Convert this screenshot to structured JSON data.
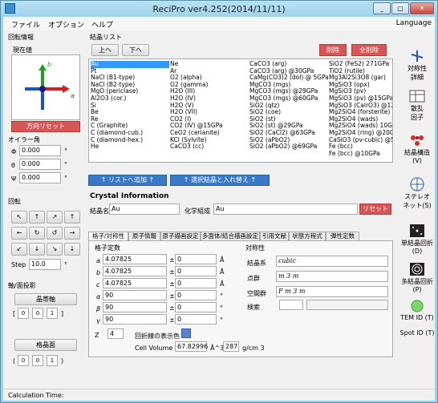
{
  "app": {
    "title": "ReciPro  ver4.252(2014/11/11)"
  },
  "window_buttons": {
    "min": "_",
    "max": "▢",
    "close": "✕"
  },
  "menu": {
    "file": "ファイル",
    "options": "オプション",
    "help": "ヘルプ",
    "language": "Language"
  },
  "rotation": {
    "group": "回転情報",
    "current": "現在値",
    "reset": "方向リセット",
    "axis_b": "b",
    "axis_a": "a"
  },
  "euler": {
    "group": "オイラー角",
    "phi": "Φ",
    "theta": "θ",
    "psi": "Ψ",
    "phi_val": "0.000",
    "theta_val": "0.000",
    "psi_val": "0.000",
    "unit": "°"
  },
  "rotate": {
    "group": "回転",
    "step_label": "Step",
    "step_val": "10.0",
    "unit": "°"
  },
  "axis_plane": {
    "group": "軸/面投影",
    "zone_axis": "晶帯軸",
    "plane": "格晶面",
    "zone_vals": [
      "0",
      "0",
      "1"
    ],
    "plane_vals": [
      "0",
      "0",
      "1"
    ],
    "lb": "[",
    "rb": "]",
    "lp": "(",
    "rp": ")"
  },
  "crystal_list": {
    "group": "結晶リスト",
    "up": "上へ",
    "down": "下へ",
    "delete": "削除",
    "delete_all": "全削除",
    "add": "↑ リストへ追加 ↑",
    "replace": "↑ 選択結晶と入れ替え ↑",
    "col1": [
      "Au",
      "Pt",
      "NaCl (B1-type)",
      "NaCl (B2-type)",
      "MgO (periclase)",
      "Al2O3 (cor.)",
      "Si",
      "Be",
      "Re",
      "C (Graphite)",
      "C (diamond-cub.)",
      "C (diamond-hex.)",
      "He"
    ],
    "col2": [
      "Ne",
      "Ar",
      "O2 (alpha)",
      "O2 (gamma)",
      "H2O (III)",
      "H2O (IV)",
      "H2O (V)",
      "H2O (VII)",
      "CO2 (I)",
      "CO2 (IV) @15GPa",
      "CeO2 (cerianite)",
      "KCl (Sylvite)",
      "CaCO3 (cc)"
    ],
    "col3": [
      "CaCO3 (arg)",
      "CaCO3 (arg) @30GPa",
      "CaMg(CO3)2 (dol) @ 5GPa",
      "MgCO3 (mgs)",
      "MgCO3 (mgs) @29GPa",
      "MgCO3 (mgs) @60GPa",
      "SiO2 (qtz)",
      "SiO2 (coe)",
      "SiO2 (st)",
      "SiO2 (st) @29GPa",
      "SiO2 (CaCl2) @63GPa",
      "SiO2 (aPbO2)",
      "SiO2 (aPbO2) @69GPa"
    ],
    "col4": [
      "SiO2 (FeS2) 271GPa",
      "TiO2 (rutile)",
      "Mg3Al2Si3O8 (gar)",
      "MgSiO3 (opx)",
      "MgSiO3 (pv)",
      "MgSiO3 (pv) @15GPa",
      "MgSiO3 (CalrO3) @121",
      "Mg2SiO4 (forsterite)",
      "Mg2SiO4 (wads)",
      "Mg2SiO4 (wads) 10GP",
      "Mg2SiO4 (ring) @20G",
      "CaSiO3 (pv-cubic) @50",
      "Fe (bcc)",
      "Fe (bcc) @10GPa"
    ]
  },
  "crystal_info": {
    "title": "Crystal Information",
    "name_label": "結晶名",
    "name_val": "Au",
    "comp_label": "化学組成",
    "comp_val": "Au",
    "reset": "リセット",
    "tabs": [
      "格子/対称性",
      "原子情報",
      "原子描画設定",
      "多面体/結合描画設定",
      "引用文献",
      "状態方程式",
      "弾性定数"
    ],
    "lattice_title": "格子定数",
    "a": "a",
    "b": "b",
    "c": "c",
    "alpha": "α",
    "beta": "β",
    "gamma": "γ",
    "a_val": "4.07825",
    "b_val": "4.07825",
    "c_val": "4.07825",
    "alpha_val": "90",
    "beta_val": "90",
    "gamma_val": "90",
    "err_val": "0",
    "pm": "±",
    "ang": "Å",
    "deg": "°",
    "sym_title": "対称性",
    "crystal_system_label": "結晶系",
    "crystal_system": "cubic",
    "point_group_label": "点群",
    "point_group": "m 3 m",
    "space_group_label": "空間群",
    "space_group": "F m 3 m",
    "search_label": "検索",
    "z_label": "Z",
    "z_val": "4",
    "diff_color_label": "回折線の表示色",
    "cell_volume_label": "Cell Volume",
    "cell_volume": "67.82996",
    "cell_unit": "Å^3",
    "density": "287",
    "density_unit": "g/cm 3"
  },
  "sidebar": {
    "items": [
      "対称性\n詳細",
      "散乱\n因子",
      "結晶構造\n(V)",
      "ステレオ\nネット(S)",
      "単結晶回折\n(D)",
      "多結晶回折\n(P)",
      "TEM ID (T)",
      "Spot ID (T)"
    ]
  },
  "status": {
    "text": "Calculation Time:"
  },
  "colors": {
    "window": "#9fd3ea",
    "red": "#d85555",
    "blue": "#3a79c8",
    "swatch": "#5b7fd1"
  }
}
